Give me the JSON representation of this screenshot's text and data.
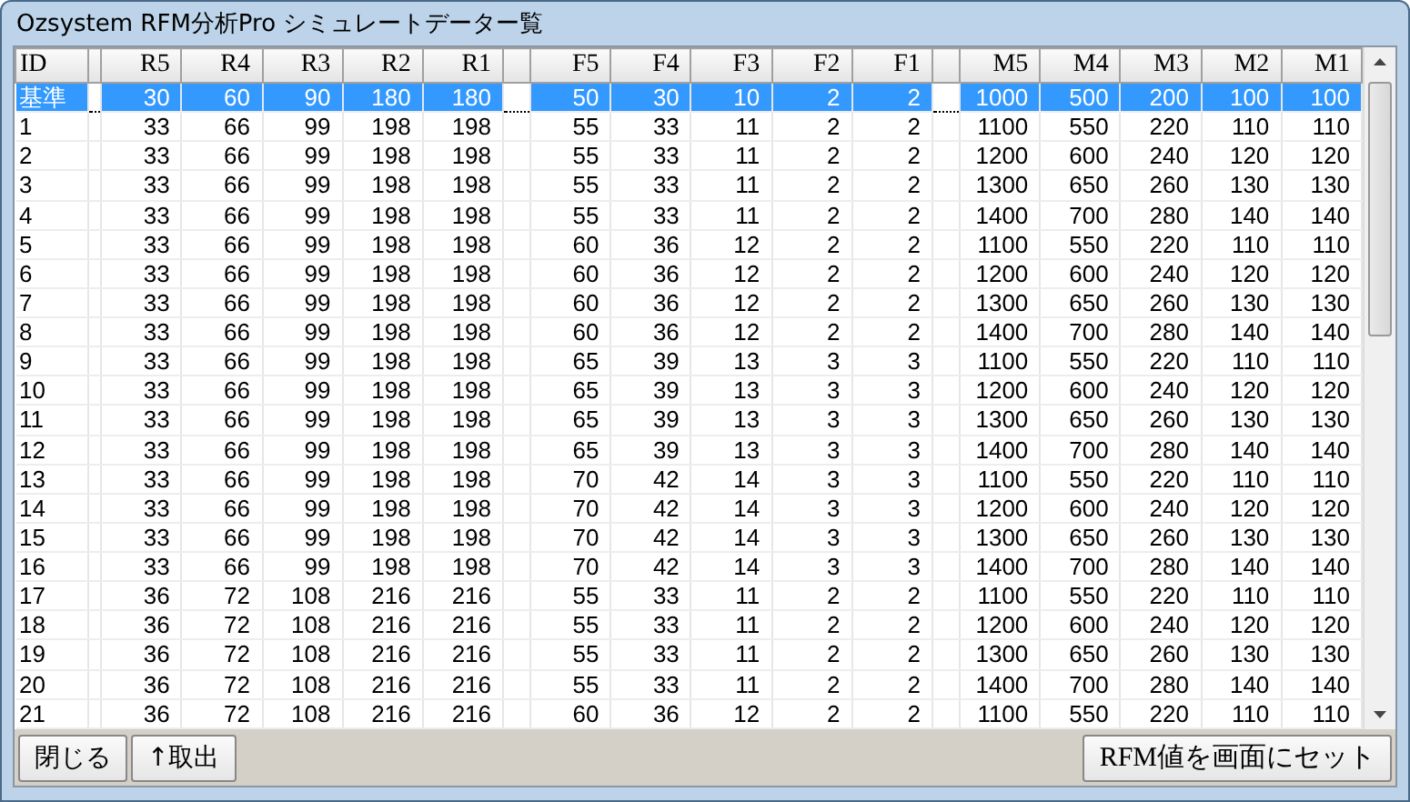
{
  "window": {
    "title": "Ozsystem RFM分析Pro シミュレートデーター覧"
  },
  "table": {
    "columns": [
      {
        "label": "ID",
        "gap_before": false
      },
      {
        "label": "R5",
        "gap_before": true
      },
      {
        "label": "R4",
        "gap_before": false
      },
      {
        "label": "R3",
        "gap_before": false
      },
      {
        "label": "R2",
        "gap_before": false
      },
      {
        "label": "R1",
        "gap_before": false
      },
      {
        "label": "F5",
        "gap_before": true
      },
      {
        "label": "F4",
        "gap_before": false
      },
      {
        "label": "F3",
        "gap_before": false
      },
      {
        "label": "F2",
        "gap_before": false
      },
      {
        "label": "F1",
        "gap_before": false
      },
      {
        "label": "M5",
        "gap_before": true
      },
      {
        "label": "M4",
        "gap_before": false
      },
      {
        "label": "M3",
        "gap_before": false
      },
      {
        "label": "M2",
        "gap_before": false
      },
      {
        "label": "M1",
        "gap_before": false
      }
    ],
    "rows": [
      {
        "selected": true,
        "cells": [
          "基準",
          "30",
          "60",
          "90",
          "180",
          "180",
          "50",
          "30",
          "10",
          "2",
          "2",
          "1000",
          "500",
          "200",
          "100",
          "100"
        ]
      },
      {
        "selected": false,
        "cells": [
          "1",
          "33",
          "66",
          "99",
          "198",
          "198",
          "55",
          "33",
          "11",
          "2",
          "2",
          "1100",
          "550",
          "220",
          "110",
          "110"
        ]
      },
      {
        "selected": false,
        "cells": [
          "2",
          "33",
          "66",
          "99",
          "198",
          "198",
          "55",
          "33",
          "11",
          "2",
          "2",
          "1200",
          "600",
          "240",
          "120",
          "120"
        ]
      },
      {
        "selected": false,
        "cells": [
          "3",
          "33",
          "66",
          "99",
          "198",
          "198",
          "55",
          "33",
          "11",
          "2",
          "2",
          "1300",
          "650",
          "260",
          "130",
          "130"
        ]
      },
      {
        "selected": false,
        "cells": [
          "4",
          "33",
          "66",
          "99",
          "198",
          "198",
          "55",
          "33",
          "11",
          "2",
          "2",
          "1400",
          "700",
          "280",
          "140",
          "140"
        ]
      },
      {
        "selected": false,
        "cells": [
          "5",
          "33",
          "66",
          "99",
          "198",
          "198",
          "60",
          "36",
          "12",
          "2",
          "2",
          "1100",
          "550",
          "220",
          "110",
          "110"
        ]
      },
      {
        "selected": false,
        "cells": [
          "6",
          "33",
          "66",
          "99",
          "198",
          "198",
          "60",
          "36",
          "12",
          "2",
          "2",
          "1200",
          "600",
          "240",
          "120",
          "120"
        ]
      },
      {
        "selected": false,
        "cells": [
          "7",
          "33",
          "66",
          "99",
          "198",
          "198",
          "60",
          "36",
          "12",
          "2",
          "2",
          "1300",
          "650",
          "260",
          "130",
          "130"
        ]
      },
      {
        "selected": false,
        "cells": [
          "8",
          "33",
          "66",
          "99",
          "198",
          "198",
          "60",
          "36",
          "12",
          "2",
          "2",
          "1400",
          "700",
          "280",
          "140",
          "140"
        ]
      },
      {
        "selected": false,
        "cells": [
          "9",
          "33",
          "66",
          "99",
          "198",
          "198",
          "65",
          "39",
          "13",
          "3",
          "3",
          "1100",
          "550",
          "220",
          "110",
          "110"
        ]
      },
      {
        "selected": false,
        "cells": [
          "10",
          "33",
          "66",
          "99",
          "198",
          "198",
          "65",
          "39",
          "13",
          "3",
          "3",
          "1200",
          "600",
          "240",
          "120",
          "120"
        ]
      },
      {
        "selected": false,
        "cells": [
          "11",
          "33",
          "66",
          "99",
          "198",
          "198",
          "65",
          "39",
          "13",
          "3",
          "3",
          "1300",
          "650",
          "260",
          "130",
          "130"
        ]
      },
      {
        "selected": false,
        "cells": [
          "12",
          "33",
          "66",
          "99",
          "198",
          "198",
          "65",
          "39",
          "13",
          "3",
          "3",
          "1400",
          "700",
          "280",
          "140",
          "140"
        ]
      },
      {
        "selected": false,
        "cells": [
          "13",
          "33",
          "66",
          "99",
          "198",
          "198",
          "70",
          "42",
          "14",
          "3",
          "3",
          "1100",
          "550",
          "220",
          "110",
          "110"
        ]
      },
      {
        "selected": false,
        "cells": [
          "14",
          "33",
          "66",
          "99",
          "198",
          "198",
          "70",
          "42",
          "14",
          "3",
          "3",
          "1200",
          "600",
          "240",
          "120",
          "120"
        ]
      },
      {
        "selected": false,
        "cells": [
          "15",
          "33",
          "66",
          "99",
          "198",
          "198",
          "70",
          "42",
          "14",
          "3",
          "3",
          "1300",
          "650",
          "260",
          "130",
          "130"
        ]
      },
      {
        "selected": false,
        "cells": [
          "16",
          "33",
          "66",
          "99",
          "198",
          "198",
          "70",
          "42",
          "14",
          "3",
          "3",
          "1400",
          "700",
          "280",
          "140",
          "140"
        ]
      },
      {
        "selected": false,
        "cells": [
          "17",
          "36",
          "72",
          "108",
          "216",
          "216",
          "55",
          "33",
          "11",
          "2",
          "2",
          "1100",
          "550",
          "220",
          "110",
          "110"
        ]
      },
      {
        "selected": false,
        "cells": [
          "18",
          "36",
          "72",
          "108",
          "216",
          "216",
          "55",
          "33",
          "11",
          "2",
          "2",
          "1200",
          "600",
          "240",
          "120",
          "120"
        ]
      },
      {
        "selected": false,
        "cells": [
          "19",
          "36",
          "72",
          "108",
          "216",
          "216",
          "55",
          "33",
          "11",
          "2",
          "2",
          "1300",
          "650",
          "260",
          "130",
          "130"
        ]
      },
      {
        "selected": false,
        "cells": [
          "20",
          "36",
          "72",
          "108",
          "216",
          "216",
          "55",
          "33",
          "11",
          "2",
          "2",
          "1400",
          "700",
          "280",
          "140",
          "140"
        ]
      },
      {
        "selected": false,
        "cells": [
          "21",
          "36",
          "72",
          "108",
          "216",
          "216",
          "60",
          "36",
          "12",
          "2",
          "2",
          "1100",
          "550",
          "220",
          "110",
          "110"
        ]
      }
    ]
  },
  "buttons": {
    "left": [
      "閉じる",
      "↑取出"
    ],
    "right": [
      "RFM値を画面にセット"
    ]
  }
}
